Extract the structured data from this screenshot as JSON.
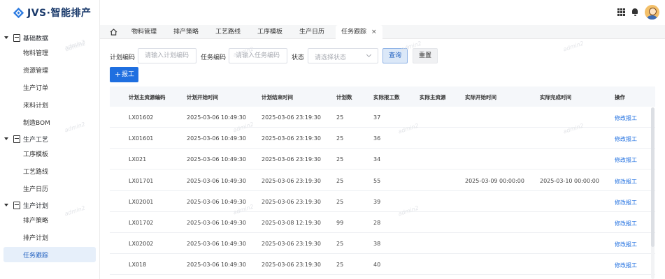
{
  "app": {
    "logo_text": "JVS·智能排产"
  },
  "sidebar": {
    "groups": [
      {
        "label": "基础数据",
        "items": [
          "物料管理",
          "资源管理",
          "生产订单",
          "来料计划",
          "制造BOM"
        ]
      },
      {
        "label": "生产工艺",
        "items": [
          "工序模板",
          "工艺路线",
          "生产日历"
        ]
      },
      {
        "label": "生产计划",
        "items": [
          "排产策略",
          "排产计划",
          "任务跟踪"
        ]
      }
    ],
    "active_item": "任务跟踪"
  },
  "topbar": {
    "icons": [
      "apps-grid-icon",
      "bell-icon",
      "user-avatar"
    ]
  },
  "tabs": {
    "items": [
      "物料管理",
      "排产策略",
      "工艺路线",
      "工序模板",
      "生产日历",
      "任务跟踪"
    ],
    "active": "任务跟踪",
    "close_symbol": "×"
  },
  "filters": {
    "plan_code_label": "计划编码",
    "plan_code_placeholder": "请输入计划编码",
    "task_code_label": "任务编码",
    "task_code_placeholder": "请输入任务编码",
    "status_label": "状态",
    "status_placeholder": "请选择状态",
    "query_label": "查询",
    "reset_label": "重置"
  },
  "toolbar": {
    "add_plus": "+",
    "add_label": "报工"
  },
  "table": {
    "columns": [
      "计划主资源编码",
      "计划开始时间",
      "计划结束时间",
      "计划数",
      "实际报工数",
      "实际主资源",
      "实际开始时间",
      "实际完成时间",
      "操作"
    ],
    "rows": [
      [
        "LX01602",
        "2025-03-06 10:49:30",
        "2025-03-06 23:19:30",
        "25",
        "37",
        "",
        "",
        "",
        "修改报工"
      ],
      [
        "LX01601",
        "2025-03-06 10:49:30",
        "2025-03-06 23:19:30",
        "25",
        "36",
        "",
        "",
        "",
        "修改报工"
      ],
      [
        "LX021",
        "2025-03-06 10:49:30",
        "2025-03-06 23:19:30",
        "25",
        "34",
        "",
        "",
        "",
        "修改报工"
      ],
      [
        "LX01701",
        "2025-03-06 10:49:30",
        "2025-03-06 23:19:30",
        "25",
        "55",
        "",
        "2025-03-09 00:00:00",
        "2025-03-10 00:00:00",
        "修改报工"
      ],
      [
        "LX02001",
        "2025-03-06 10:49:30",
        "2025-03-06 23:19:30",
        "25",
        "39",
        "",
        "",
        "",
        "修改报工"
      ],
      [
        "LX01702",
        "2025-03-06 10:49:30",
        "2025-03-08 12:19:30",
        "99",
        "28",
        "",
        "",
        "",
        "修改报工"
      ],
      [
        "LX02002",
        "2025-03-06 10:49:30",
        "2025-03-06 23:19:30",
        "25",
        "38",
        "",
        "",
        "",
        "修改报工"
      ],
      [
        "LX018",
        "2025-03-06 10:49:30",
        "2025-03-06 23:19:30",
        "25",
        "40",
        "",
        "",
        "",
        "修改报工"
      ]
    ]
  },
  "watermark": "admin2",
  "colors": {
    "primary": "#1f6fe0",
    "active_bg": "#e6effa",
    "brand_text": "#1a3a6b"
  }
}
